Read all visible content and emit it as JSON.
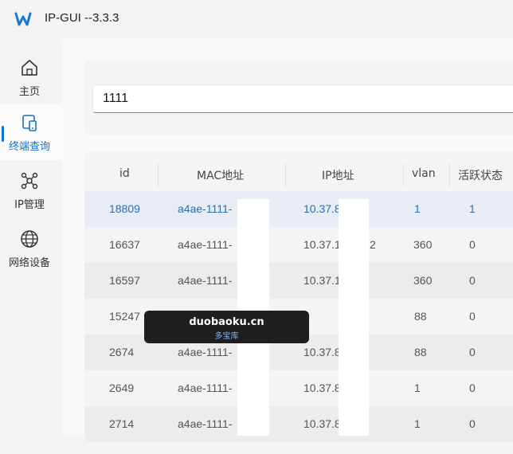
{
  "app": {
    "title": "IP-GUI --3.3.3",
    "logo_icon": "w-logo-icon",
    "accent": "#1570c9"
  },
  "sidebar": {
    "items": [
      {
        "label": "主页",
        "icon": "home-icon",
        "active": false
      },
      {
        "label": "终端查询",
        "icon": "terminal-devices-icon",
        "active": true
      },
      {
        "label": "IP管理",
        "icon": "network-nodes-icon",
        "active": false
      },
      {
        "label": "网络设备",
        "icon": "globe-icon",
        "active": false
      }
    ]
  },
  "search": {
    "value": "1111"
  },
  "table": {
    "headers": [
      "id",
      "MAC地址",
      "IP地址",
      "vlan",
      "活跃状态"
    ],
    "rows": [
      {
        "id": "18809",
        "mac": "a4ae-1111-",
        "ip": "10.37.8",
        "vlan": "1",
        "active": "1"
      },
      {
        "id": "16637",
        "mac": "a4ae-1111-",
        "ip": "10.37.1",
        "ip_suffix": "2",
        "vlan": "360",
        "active": "0"
      },
      {
        "id": "16597",
        "mac": "a4ae-1111-",
        "ip": "10.37.1",
        "vlan": "360",
        "active": "0"
      },
      {
        "id": "15247",
        "mac": "",
        "ip": "",
        "vlan": "88",
        "active": "0"
      },
      {
        "id": "2674",
        "mac": "a4ae-1111-",
        "ip": "10.37.8",
        "vlan": "88",
        "active": "0"
      },
      {
        "id": "2649",
        "mac": "a4ae-1111-",
        "ip": "10.37.8",
        "vlan": "1",
        "active": "0"
      },
      {
        "id": "2714",
        "mac": "a4ae-1111-",
        "ip": "10.37.8",
        "vlan": "1",
        "active": "0"
      }
    ]
  },
  "watermark": {
    "text": "duobaoku.cn",
    "subtext": "多宝库"
  }
}
